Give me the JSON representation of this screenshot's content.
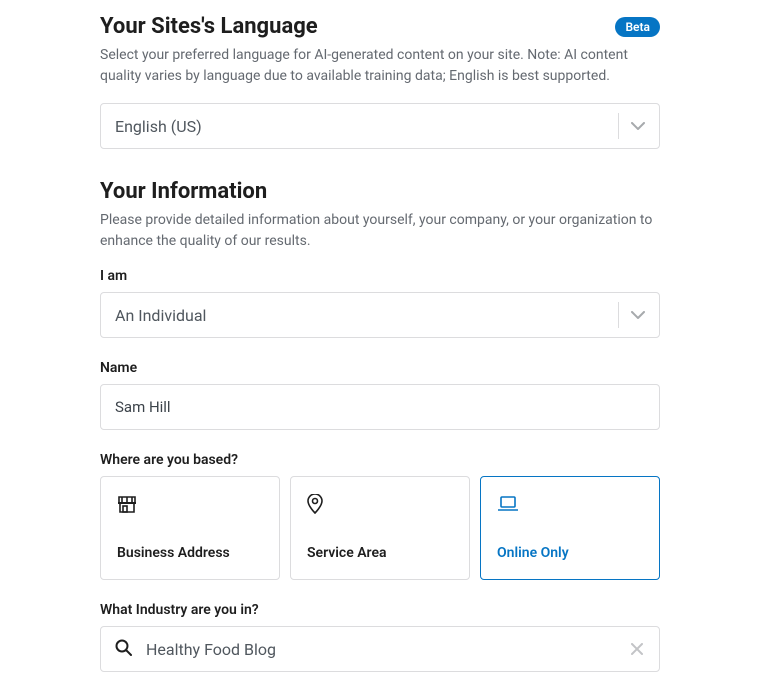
{
  "language": {
    "title": "Your Sites's Language",
    "badge": "Beta",
    "desc": "Select your preferred language for AI-generated content on your site. Note: AI content quality varies by language due to available training data; English is best supported.",
    "value": "English (US)"
  },
  "info": {
    "title": "Your Information",
    "desc": "Please provide detailed information about yourself, your company, or your organization to enhance the quality of our results.",
    "iam": {
      "label": "I am",
      "value": "An Individual"
    },
    "name": {
      "label": "Name",
      "value": "Sam Hill"
    },
    "based": {
      "label": "Where are you based?",
      "options": {
        "business": "Business Address",
        "service": "Service Area",
        "online": "Online Only"
      },
      "selected": "online"
    },
    "industry": {
      "label": "What Industry are you in?",
      "value": "Healthy Food Blog"
    }
  }
}
